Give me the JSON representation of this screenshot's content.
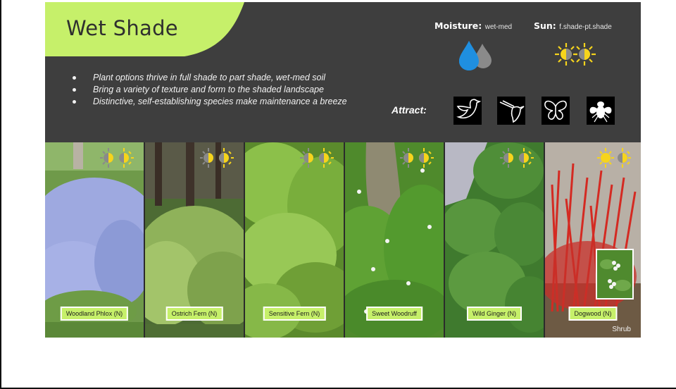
{
  "title": "Wet Shade",
  "bullets": [
    "Plant options thrive in full shade to part shade, wet-med soil",
    "Bring a variety of texture and form to the shaded landscape",
    "Distinctive, self-establishing species make maintenance a breeze"
  ],
  "moisture": {
    "label": "Moisture:",
    "value": "wet-med"
  },
  "sun": {
    "label": "Sun:",
    "value": "f.shade-pt.shade"
  },
  "attract": {
    "label": "Attract:",
    "icons": [
      "bird-icon",
      "hummingbird-icon",
      "butterfly-icon",
      "fly-icon"
    ]
  },
  "plants": [
    {
      "name": "Woodland Phlox (N)",
      "sun": "shade-pt-shade"
    },
    {
      "name": "Ostrich Fern (N)",
      "sun": "shade-pt-shade"
    },
    {
      "name": "Sensitive Fern (N)",
      "sun": "shade-pt-shade"
    },
    {
      "name": "Sweet Woodruff",
      "sun": "shade-pt-shade"
    },
    {
      "name": "Wild Ginger (N)",
      "sun": "shade-pt-shade"
    },
    {
      "name": "Dogwood (N)",
      "sun": "sun-pt-shade",
      "note": "Shrub"
    }
  ],
  "colors": {
    "accent": "#c6f06a",
    "panel": "#3e3e3e",
    "water": "#1f8fe0",
    "water_secondary": "#8a8a8a",
    "sun": "#f6d41c"
  }
}
